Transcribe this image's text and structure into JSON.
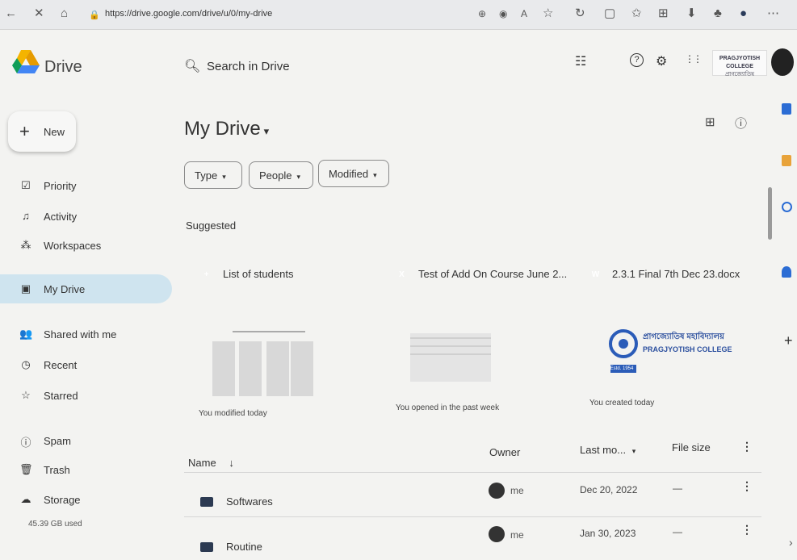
{
  "browser": {
    "url": "https://drive.google.com/drive/u/0/my-drive",
    "back_glyph": "←",
    "close_glyph": "✕",
    "home_glyph": "⌂",
    "lock_glyph": "🔒",
    "right_icons": [
      "⊕",
      "◉",
      "A",
      "☆",
      "↻",
      "▢",
      "✩",
      "⊞",
      "⬇",
      "♣",
      "●",
      "⋯"
    ]
  },
  "header": {
    "app_name": "Drive",
    "search_placeholder": "Search in Drive",
    "filter_glyph": "☷",
    "help_glyph": "?",
    "settings_glyph": "⚙",
    "apps_glyph": "⋮⋮",
    "college_logo_lines": [
      "PRAGJYOTISH COLLEGE",
      "প্ৰাগজ্যোতিষ"
    ],
    "brand_colors": {
      "yellow": "#f4b400",
      "green": "#0f9d58",
      "blue": "#4285f4"
    }
  },
  "new_button": {
    "label": "New",
    "glyph": "+"
  },
  "sidebar": {
    "items": [
      {
        "label": "Priority",
        "glyph": "☑"
      },
      {
        "label": "Activity",
        "glyph": "♫"
      },
      {
        "label": "Workspaces",
        "glyph": "⁂"
      },
      {
        "label": "My Drive",
        "glyph": "▣"
      },
      {
        "label": "Shared with me",
        "glyph": "👥"
      },
      {
        "label": "Recent",
        "glyph": "◷"
      },
      {
        "label": "Starred",
        "glyph": "☆"
      },
      {
        "label": "Spam",
        "glyph": "ⓘ"
      },
      {
        "label": "Trash",
        "glyph": "🗑"
      },
      {
        "label": "Storage",
        "glyph": "☁"
      }
    ],
    "storage_used": "45.39 GB used",
    "active_color": "#cfe4ef"
  },
  "main": {
    "title": "My Drive",
    "title_caret": "▾",
    "grid_glyph": "⊞",
    "info_glyph": "ⓘ",
    "chips": [
      {
        "label": "Type",
        "caret": "▾"
      },
      {
        "label": "People",
        "caret": "▾"
      },
      {
        "label": "Modified",
        "caret": "▾"
      }
    ],
    "suggested_label": "Suggested",
    "suggested": [
      {
        "title": "List of students",
        "icon_letter": "+",
        "icon_color": "#1e7e45",
        "reason": "You modified today"
      },
      {
        "title": "Test of Add On Course June 2...",
        "icon_letter": "X",
        "icon_color": "#1d6f42",
        "reason": "You opened in the past week"
      },
      {
        "title": "2.3.1 Final 7th Dec 23.docx",
        "icon_letter": "W",
        "icon_color": "#2b6cd4",
        "reason": "You created today"
      }
    ],
    "thumb3": {
      "bengali": "প্ৰাগজ্যোতিষ মহাবিদ্যালয়",
      "english": "PRAGJYOTISH COLLEGE",
      "estd": "Estd. 1954"
    },
    "table": {
      "headers": {
        "name": "Name",
        "sort_glyph": "↓",
        "owner": "Owner",
        "last_modified": "Last mo...",
        "last_modified_caret": "▾",
        "file_size": "File size",
        "kebab": "⋮"
      },
      "rows": [
        {
          "name": "Softwares",
          "owner": "me",
          "modified": "Dec 20, 2022",
          "size": "—",
          "kebab": "⋮"
        },
        {
          "name": "Routine",
          "owner": "me",
          "modified": "Jan 30, 2023",
          "size": "—",
          "kebab": "⋮"
        }
      ]
    }
  },
  "side_panel": {
    "add_glyph": "+",
    "expand_glyph": "›",
    "icon_colors": [
      "#2b6cd4",
      "#e8a33a",
      "#2b6cd4",
      "#2b6cd4"
    ]
  }
}
